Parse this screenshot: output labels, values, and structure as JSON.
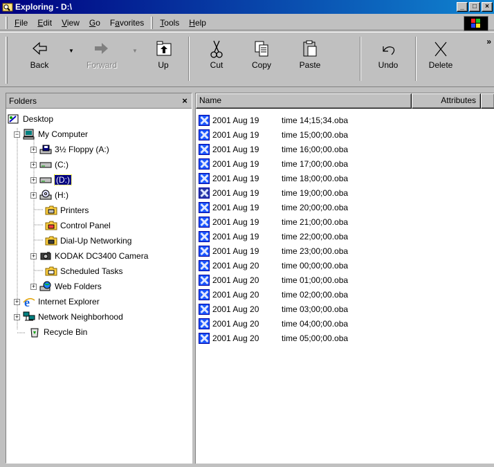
{
  "window": {
    "title": "Exploring - D:\\",
    "controls": {
      "minimize": "_",
      "maximize": "□",
      "close": "×"
    }
  },
  "menubar": {
    "items": [
      {
        "label": "File",
        "accel": "F",
        "rest": "ile"
      },
      {
        "label": "Edit",
        "accel": "E",
        "rest": "dit"
      },
      {
        "label": "View",
        "accel": "V",
        "rest": "iew"
      },
      {
        "label": "Go",
        "accel": "G",
        "rest": "o"
      },
      {
        "label": "Favorites",
        "accel": "a",
        "pre": "F",
        "rest": "vorites"
      },
      {
        "label": "Tools",
        "accel": "T",
        "rest": "ools"
      },
      {
        "label": "Help",
        "accel": "H",
        "rest": "elp"
      }
    ]
  },
  "toolbar": {
    "back": "Back",
    "forward": "Forward",
    "up": "Up",
    "cut": "Cut",
    "copy": "Copy",
    "paste": "Paste",
    "undo": "Undo",
    "delete": "Delete",
    "more": "»"
  },
  "folders": {
    "title": "Folders",
    "close": "×",
    "tree": [
      {
        "label": "Desktop",
        "icon": "desktop-icon",
        "level": 0,
        "expander": ""
      },
      {
        "label": "My Computer",
        "icon": "computer-icon",
        "level": 1,
        "expander": "−"
      },
      {
        "label": "3½ Floppy (A:)",
        "icon": "floppy-icon",
        "level": 2,
        "expander": "+"
      },
      {
        "label": "(C:)",
        "icon": "drive-icon",
        "level": 2,
        "expander": "+"
      },
      {
        "label": "(D:)",
        "icon": "drive-icon",
        "level": 2,
        "expander": "+",
        "selected": true
      },
      {
        "label": "(H:)",
        "icon": "cdrom-icon",
        "level": 2,
        "expander": "+"
      },
      {
        "label": "Printers",
        "icon": "printers-folder-icon",
        "level": 2,
        "expander": ""
      },
      {
        "label": "Control Panel",
        "icon": "control-panel-folder-icon",
        "level": 2,
        "expander": ""
      },
      {
        "label": "Dial-Up Networking",
        "icon": "dialup-folder-icon",
        "level": 2,
        "expander": ""
      },
      {
        "label": "KODAK DC3400 Camera",
        "icon": "camera-icon",
        "level": 2,
        "expander": "+"
      },
      {
        "label": "Scheduled Tasks",
        "icon": "tasks-folder-icon",
        "level": 2,
        "expander": ""
      },
      {
        "label": "Web Folders",
        "icon": "web-folders-icon",
        "level": 2,
        "expander": "+"
      },
      {
        "label": "Internet Explorer",
        "icon": "internet-explorer-icon",
        "level": 1,
        "expander": "+"
      },
      {
        "label": "Network Neighborhood",
        "icon": "network-icon",
        "level": 1,
        "expander": "+"
      },
      {
        "label": "Recycle Bin",
        "icon": "recycle-bin-icon",
        "level": 1,
        "expander": ""
      }
    ]
  },
  "files": {
    "columns": {
      "name": "Name",
      "attributes": "Attributes"
    },
    "items": [
      {
        "date": "2001 Aug 19",
        "time": "time 14;15;34.oba"
      },
      {
        "date": "2001 Aug 19",
        "time": "time 15;00;00.oba"
      },
      {
        "date": "2001 Aug 19",
        "time": "time 16;00;00.oba"
      },
      {
        "date": "2001 Aug 19",
        "time": "time 17;00;00.oba"
      },
      {
        "date": "2001 Aug 19",
        "time": "time 18;00;00.oba"
      },
      {
        "date": "2001 Aug 19",
        "time": "time 19;00;00.oba"
      },
      {
        "date": "2001 Aug 19",
        "time": "time 20;00;00.oba"
      },
      {
        "date": "2001 Aug 19",
        "time": "time 21;00;00.oba"
      },
      {
        "date": "2001 Aug 19",
        "time": "time 22;00;00.oba"
      },
      {
        "date": "2001 Aug 19",
        "time": "time 23;00;00.oba"
      },
      {
        "date": "2001 Aug 20",
        "time": "time 00;00;00.oba"
      },
      {
        "date": "2001 Aug 20",
        "time": "time 01;00;00.oba"
      },
      {
        "date": "2001 Aug 20",
        "time": "time 02;00;00.oba"
      },
      {
        "date": "2001 Aug 20",
        "time": "time 03;00;00.oba"
      },
      {
        "date": "2001 Aug 20",
        "time": "time 04;00;00.oba"
      },
      {
        "date": "2001 Aug 20",
        "time": "time 05;00;00.oba"
      }
    ]
  },
  "colors": {
    "title_start": "#000080",
    "title_end": "#1084d0",
    "face": "#c0c0c0",
    "selection": "#000080",
    "file_icon": "#1a56ff"
  }
}
